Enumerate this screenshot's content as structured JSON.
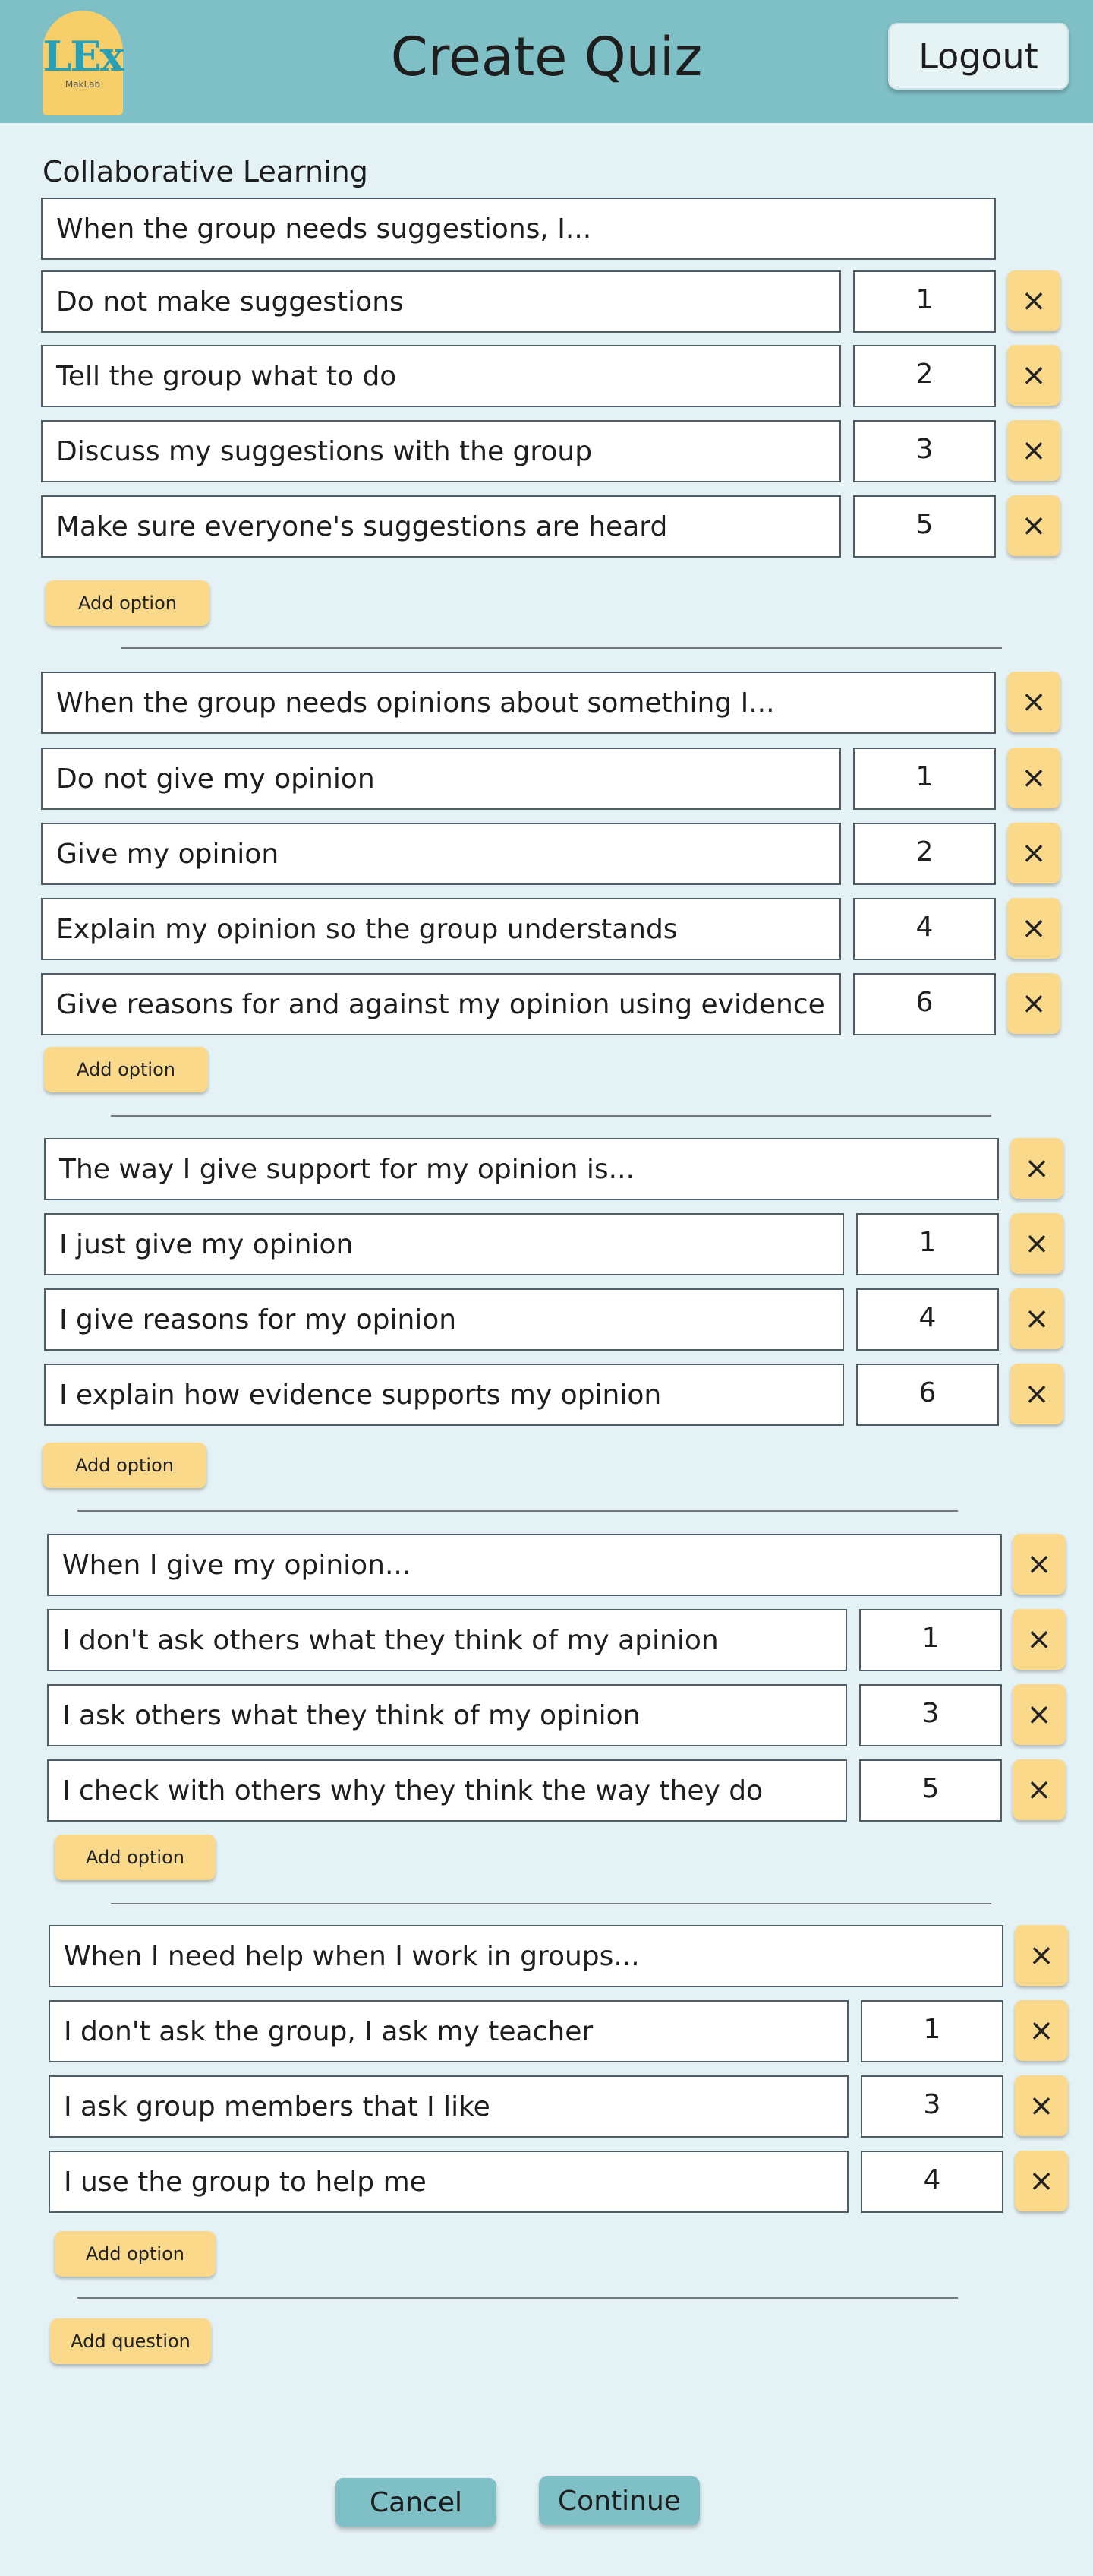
{
  "header": {
    "title": "Create Quiz",
    "logout_label": "Logout",
    "logo_text": "LEx",
    "logo_subtitle": "MakLab"
  },
  "section_label": "Collaborative Learning",
  "questions": [
    {
      "text": "When the group needs suggestions, I...",
      "options": [
        {
          "text": "Do not make suggestions",
          "score": "1"
        },
        {
          "text": "Tell the group what to do",
          "score": "2"
        },
        {
          "text": "Discuss my suggestions with the group",
          "score": "3"
        },
        {
          "text": "Make sure everyone's suggestions are heard",
          "score": "5"
        }
      ],
      "add_option_label": "Add option"
    },
    {
      "text": "When the group needs opinions about something I...",
      "options": [
        {
          "text": "Do not give my opinion",
          "score": "1"
        },
        {
          "text": "Give my opinion",
          "score": "2"
        },
        {
          "text": "Explain my opinion so the group understands",
          "score": "4"
        },
        {
          "text": "Give reasons for and against my opinion using evidence",
          "score": "6"
        }
      ],
      "add_option_label": "Add option"
    },
    {
      "text": "The way I give support for my opinion is...",
      "options": [
        {
          "text": "I just give my opinion",
          "score": "1"
        },
        {
          "text": "I give reasons for my opinion",
          "score": "4"
        },
        {
          "text": "I explain how evidence supports my opinion",
          "score": "6"
        }
      ],
      "add_option_label": "Add option"
    },
    {
      "text": "When I give my opinion...",
      "options": [
        {
          "text": "I don't ask others what they think of my apinion",
          "score": "1"
        },
        {
          "text": "I ask others what they think of my opinion",
          "score": "3"
        },
        {
          "text": "I check with others why they think the way they do",
          "score": "5"
        }
      ],
      "add_option_label": "Add option"
    },
    {
      "text": "When I need help when I work in groups...",
      "options": [
        {
          "text": "I don't ask the group, I ask my teacher",
          "score": "1"
        },
        {
          "text": "I ask group members that I like",
          "score": "3"
        },
        {
          "text": "I use the group to help me",
          "score": "4"
        }
      ],
      "add_option_label": "Add option"
    }
  ],
  "add_question_label": "Add question",
  "footer": {
    "cancel_label": "Cancel",
    "continue_label": "Continue"
  },
  "delete_icon": "×",
  "colors": {
    "header": "#7fc0c7",
    "background": "#e4f2f5",
    "accent_button": "#fbd98b",
    "logo": "#f6cf6b"
  }
}
